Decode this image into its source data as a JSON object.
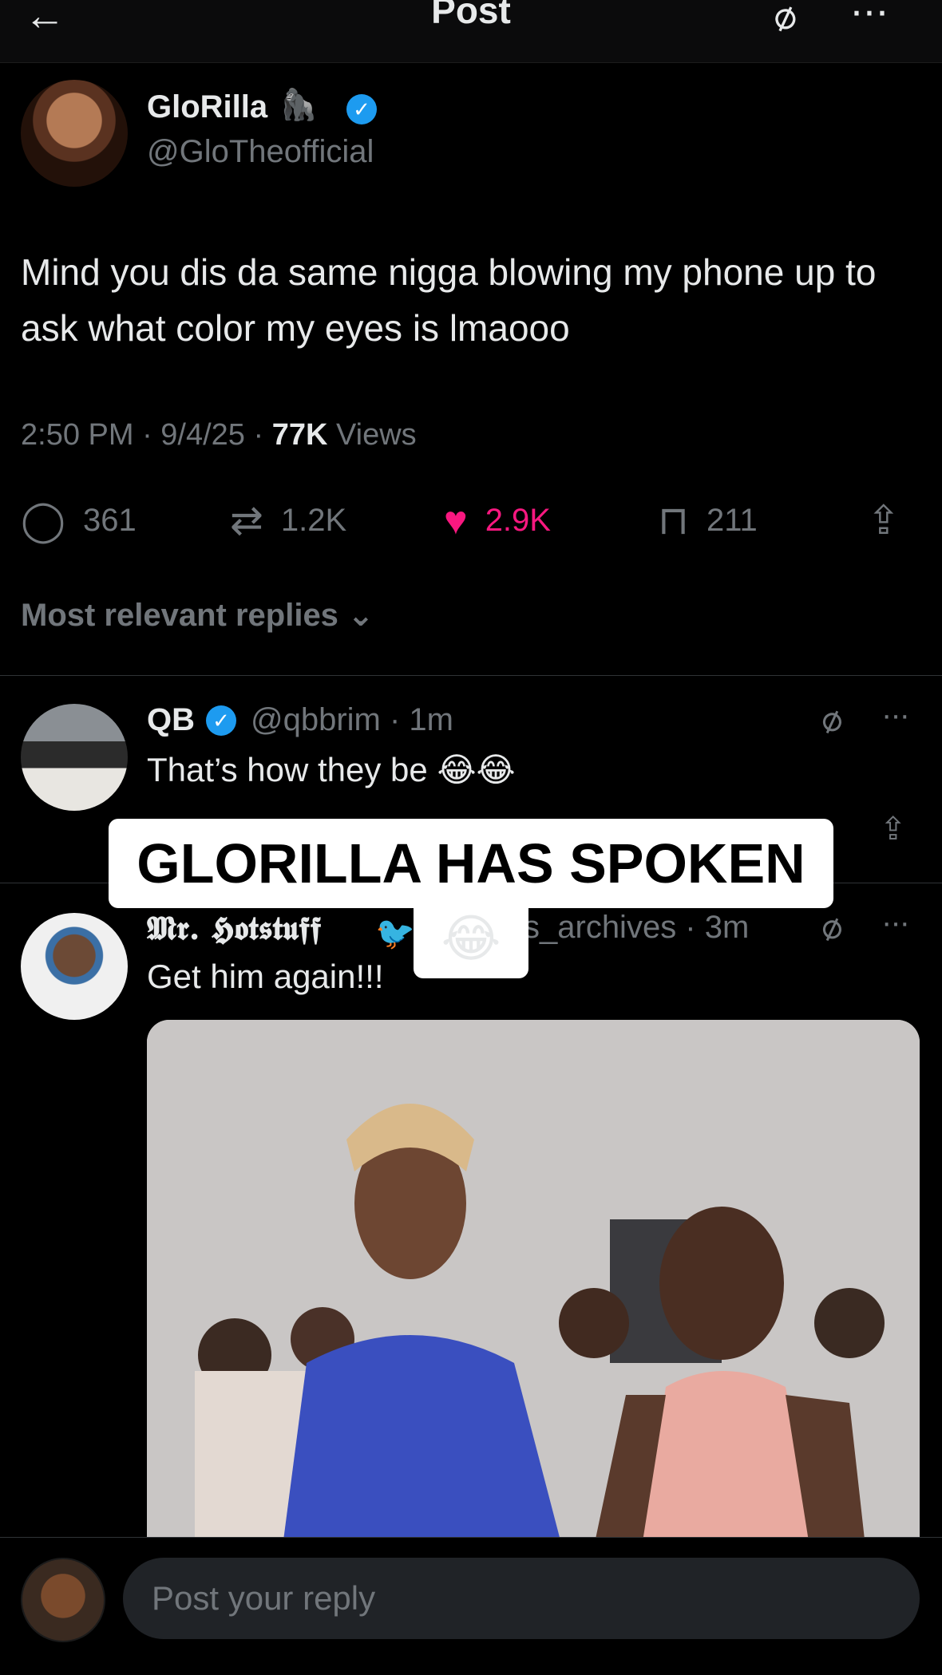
{
  "topbar": {
    "title": "Post",
    "back_icon": "arrow-left-icon",
    "grok_icon": "grok-icon",
    "more_icon": "more-icon"
  },
  "post": {
    "author_name": "GloRilla",
    "author_emoji": "🦍",
    "author_handle": "@GloTheofficial",
    "text": "Mind you dis da same nigga blowing my phone up to ask what color my eyes is lmaooo",
    "time": "2:50 PM · 9/4/25 · ",
    "views_count": "77K",
    "views_label": " Views",
    "stats": {
      "replies": "361",
      "reposts": "1.2K",
      "likes": "2.9K",
      "bookmarks": "211"
    }
  },
  "replies_header": {
    "label": "Most relevant replies"
  },
  "replies": [
    {
      "name": "QB",
      "handle": "@qbbrim · 1m",
      "text": "That’s how they be 😂😂"
    },
    {
      "name": "𝕸𝖗. 𝕳𝖔𝖙𝖘𝖙𝖚𝖋𝖋",
      "handle": "s_archives · 3m",
      "text": "Get him again!!!"
    }
  ],
  "overlay": {
    "caption": "GLORILLA HAS SPOKEN",
    "emoji": "😂"
  },
  "composer": {
    "placeholder": "Post your reply"
  },
  "colors": {
    "like": "#f91880",
    "verified": "#1d9bf0",
    "muted": "#71767b",
    "background": "#000000"
  }
}
